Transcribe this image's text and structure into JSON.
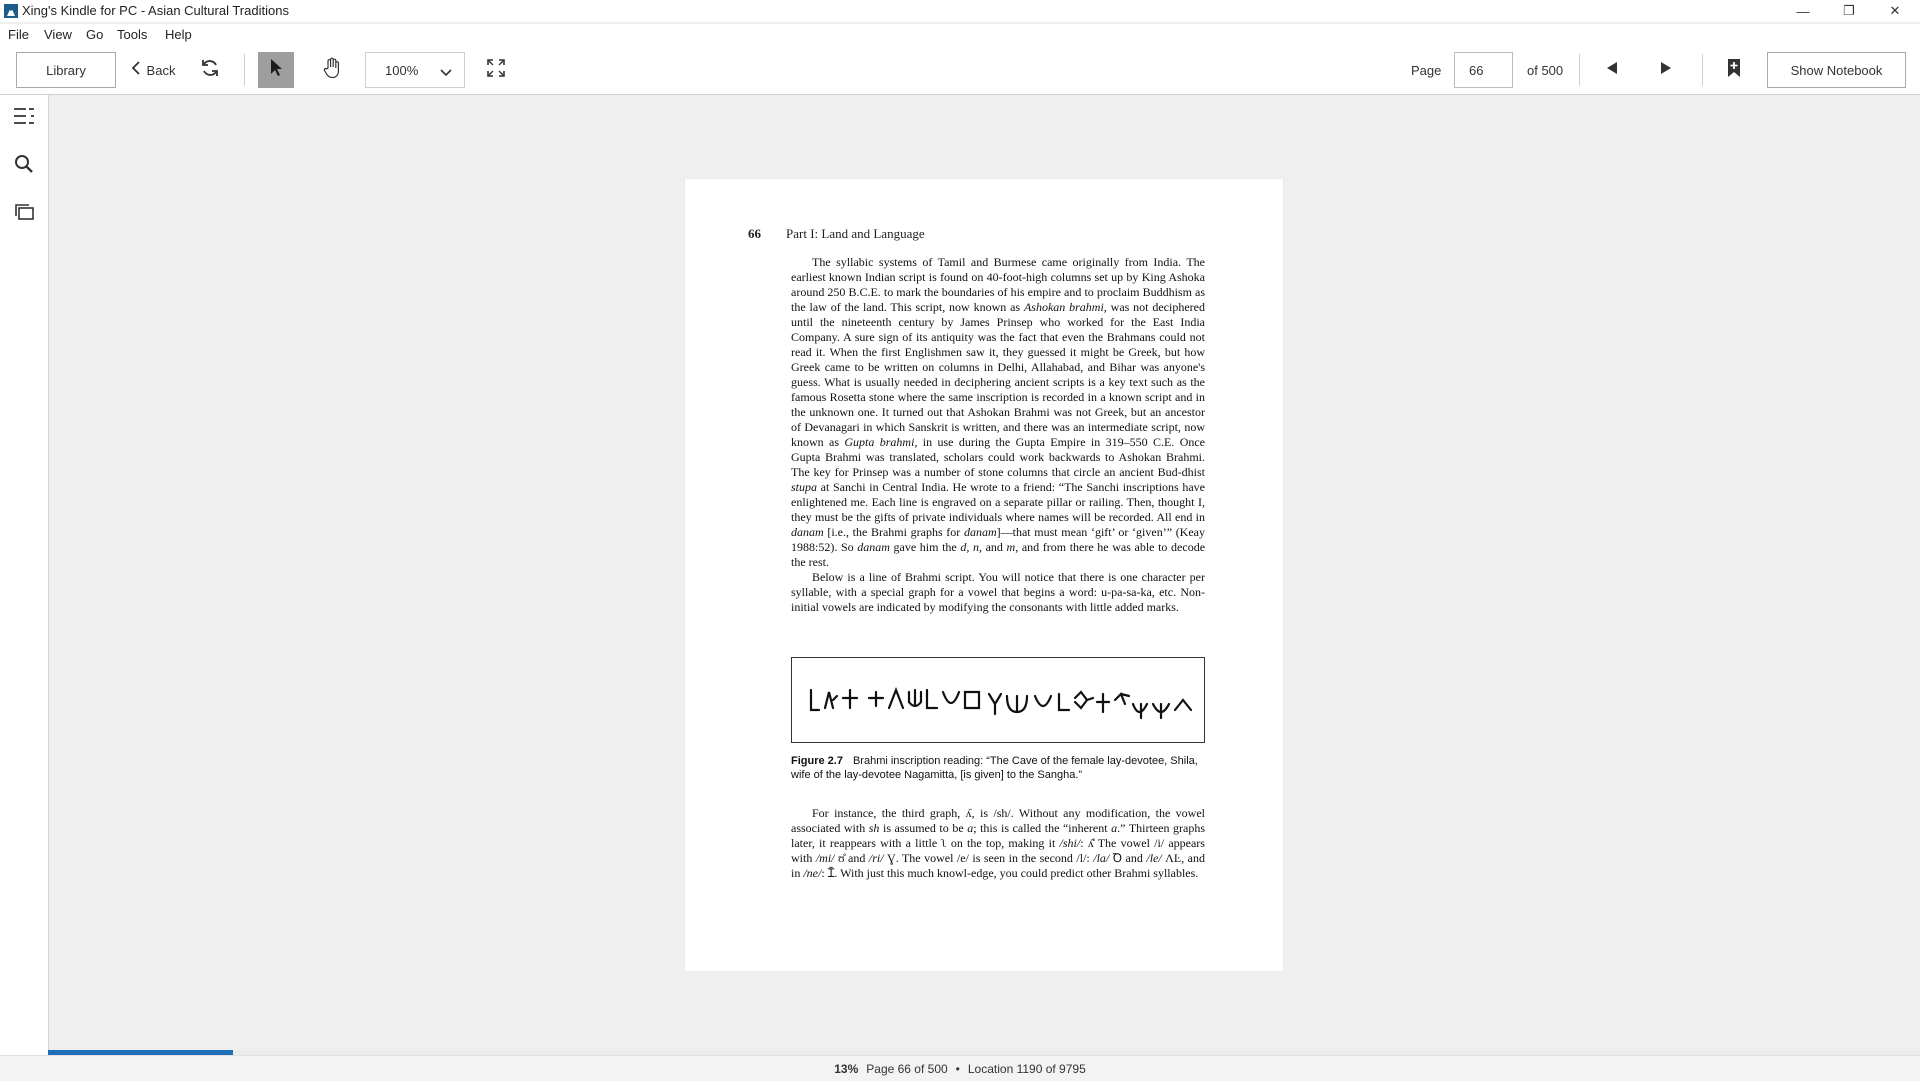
{
  "window": {
    "title": "Xing's Kindle for PC - Asian Cultural Traditions",
    "controls": {
      "minimize": "—",
      "restore": "❐",
      "close": "✕"
    }
  },
  "menu": {
    "file": "File",
    "view": "View",
    "go": "Go",
    "tools": "Tools",
    "help": "Help"
  },
  "toolbar": {
    "library": "Library",
    "back": "Back",
    "zoom": "100%",
    "page_label": "Page",
    "page_value": "66",
    "page_total": "of 500",
    "show_notebook": "Show Notebook"
  },
  "book_page": {
    "page_number": "66",
    "running_head": "Part I: Land and Language",
    "paragraph1_a": "The syllabic systems of Tamil and Burmese came originally from India. The earliest known Indian script is found on 40-foot-high columns set up by King Ashoka around 250 B.C.E. to mark the boundaries of his empire and to proclaim Buddhism as the law of the land. This script, now known as ",
    "paragraph1_b": "Ashokan brahmi",
    "paragraph1_c": ", was not deciphered until the nineteenth century by James Prinsep who worked for the East India Company. A sure sign of its antiquity was the fact that even the Brahmans could not read it. When the first Englishmen saw it, they guessed it might be Greek, but how Greek came to be written on columns in Delhi, Allahabad, and Bihar was anyone's guess. What is usually needed in deciphering ancient scripts is a key text such as the famous Rosetta stone where the same inscription is recorded in a known script and in the unknown one. It turned out that Ashokan Brahmi was not Greek, but an ancestor of Devanagari in which Sanskrit is written, and there was an intermediate script, now known as ",
    "paragraph1_d": "Gupta brahmi",
    "paragraph1_e": ", in use during the Gupta Empire in 319–550 C.E. Once Gupta Brahmi was translated, scholars could work backwards to Ashokan Brahmi. The key for Prinsep was a number of stone columns that circle an ancient Bud-dhist ",
    "paragraph1_f": "stupa",
    "paragraph1_g": " at Sanchi in Central India. He wrote to a friend: “The Sanchi inscriptions have enlightened me. Each line is engraved on a separate pillar or railing. Then, thought I, they must be the gifts of private individuals where names will be recorded. All end in ",
    "paragraph1_h": "danam",
    "paragraph1_i": " [i.e., the Brahmi graphs for ",
    "paragraph1_j": "danam",
    "paragraph1_k": "]—that must mean ‘gift’ or ‘given’” (Keay 1988:52). So ",
    "paragraph1_l": "danam",
    "paragraph1_m": " gave him the ",
    "paragraph1_n": "d, n,",
    "paragraph1_o": " and ",
    "paragraph1_p": "m",
    "paragraph1_q": ", and from there he was able to decode the rest.",
    "paragraph2": "Below is a line of Brahmi script. You will notice that there is one character per syllable, with a special graph for a vowel that begins a word: u-pa-sa-ka, etc. Non-initial vowels are indicated by modifying the consonants with little added marks.",
    "figure_label": "Figure 2.7",
    "figure_caption": "Brahmi inscription reading: “The Cave of the female lay-devotee, Shila, wife of the lay-devotee Nagamitta, [is given] to the Sangha.”",
    "paragraph3_a": "For instance, the third graph, ",
    "paragraph3_b": ", is /sh/. Without any modification, the vowel associated with ",
    "paragraph3_c": "sh",
    "paragraph3_d": " is assumed to be ",
    "paragraph3_e": "a",
    "paragraph3_f": "; this is called the “inherent ",
    "paragraph3_g": "a",
    "paragraph3_h": ".” Thirteen graphs later, it reappears with a little ",
    "paragraph3_i": " on the top, making it ",
    "paragraph3_j": "/shi/",
    "paragraph3_k": ": ",
    "paragraph3_l": " The vowel /i/ appears with ",
    "paragraph3_m": "/mi/",
    "paragraph3_n": " and ",
    "paragraph3_o": "/ri/",
    "paragraph3_p": ". The vowel /e/ is seen in the second /l/: ",
    "paragraph3_q": "/la/",
    "paragraph3_r": " and ",
    "paragraph3_s": "/le/",
    "paragraph3_t": ", and in ",
    "paragraph3_u": "/ne/",
    "paragraph3_v": ": ",
    "paragraph3_w": ". With just this much knowl-edge, you could predict other Brahmi syllables."
  },
  "status": {
    "percent": "13%",
    "progress": 0.099,
    "page_info": "Page 66 of 500",
    "separator": "•",
    "location": "Location 1190 of 9795"
  },
  "colors": {
    "progress_fill": "#1f6fb8",
    "active_tool": "#9e9e9e"
  }
}
